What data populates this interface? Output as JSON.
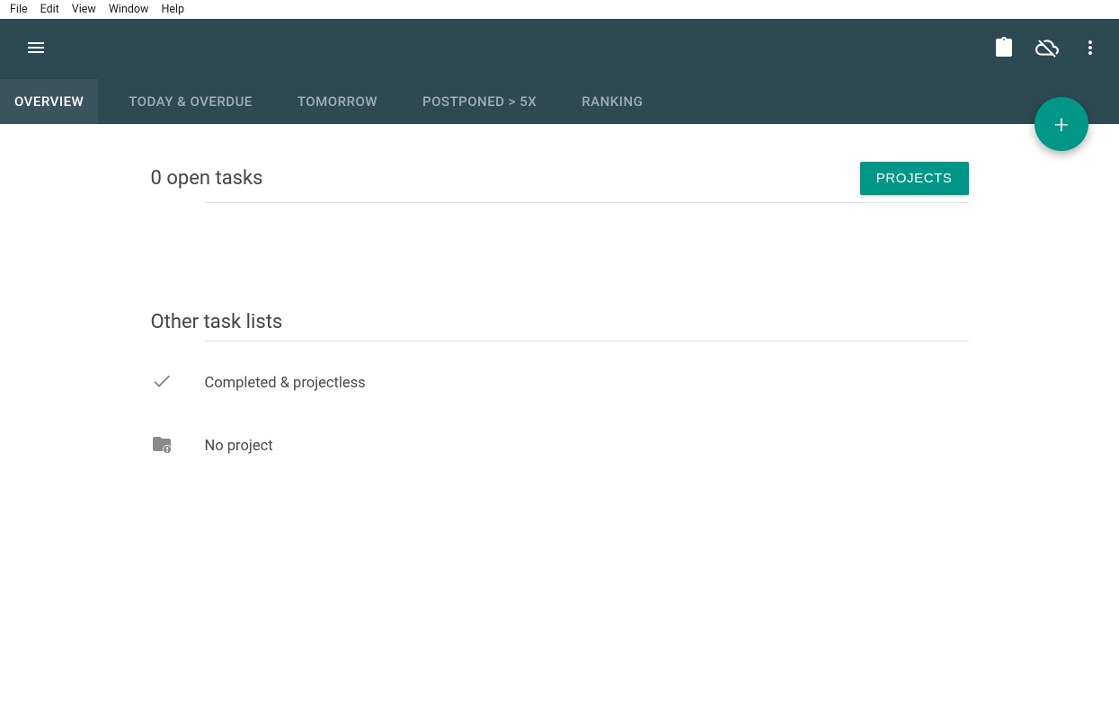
{
  "os_menu": {
    "file": "File",
    "edit": "Edit",
    "view": "View",
    "window": "Window",
    "help": "Help"
  },
  "tabs": {
    "overview": "OVERVIEW",
    "today": "TODAY & OVERDUE",
    "tomorrow": "TOMORROW",
    "postponed": "POSTPONED > 5X",
    "ranking": "RANKING"
  },
  "main": {
    "open_tasks": "0 open tasks",
    "projects_button": "PROJECTS",
    "other_lists_title": "Other task lists",
    "lists": {
      "completed": "Completed & projectless",
      "no_project": "No project"
    }
  },
  "fab": {
    "label": "+"
  },
  "colors": {
    "header_bg": "#2d4a54",
    "accent": "#009688"
  }
}
